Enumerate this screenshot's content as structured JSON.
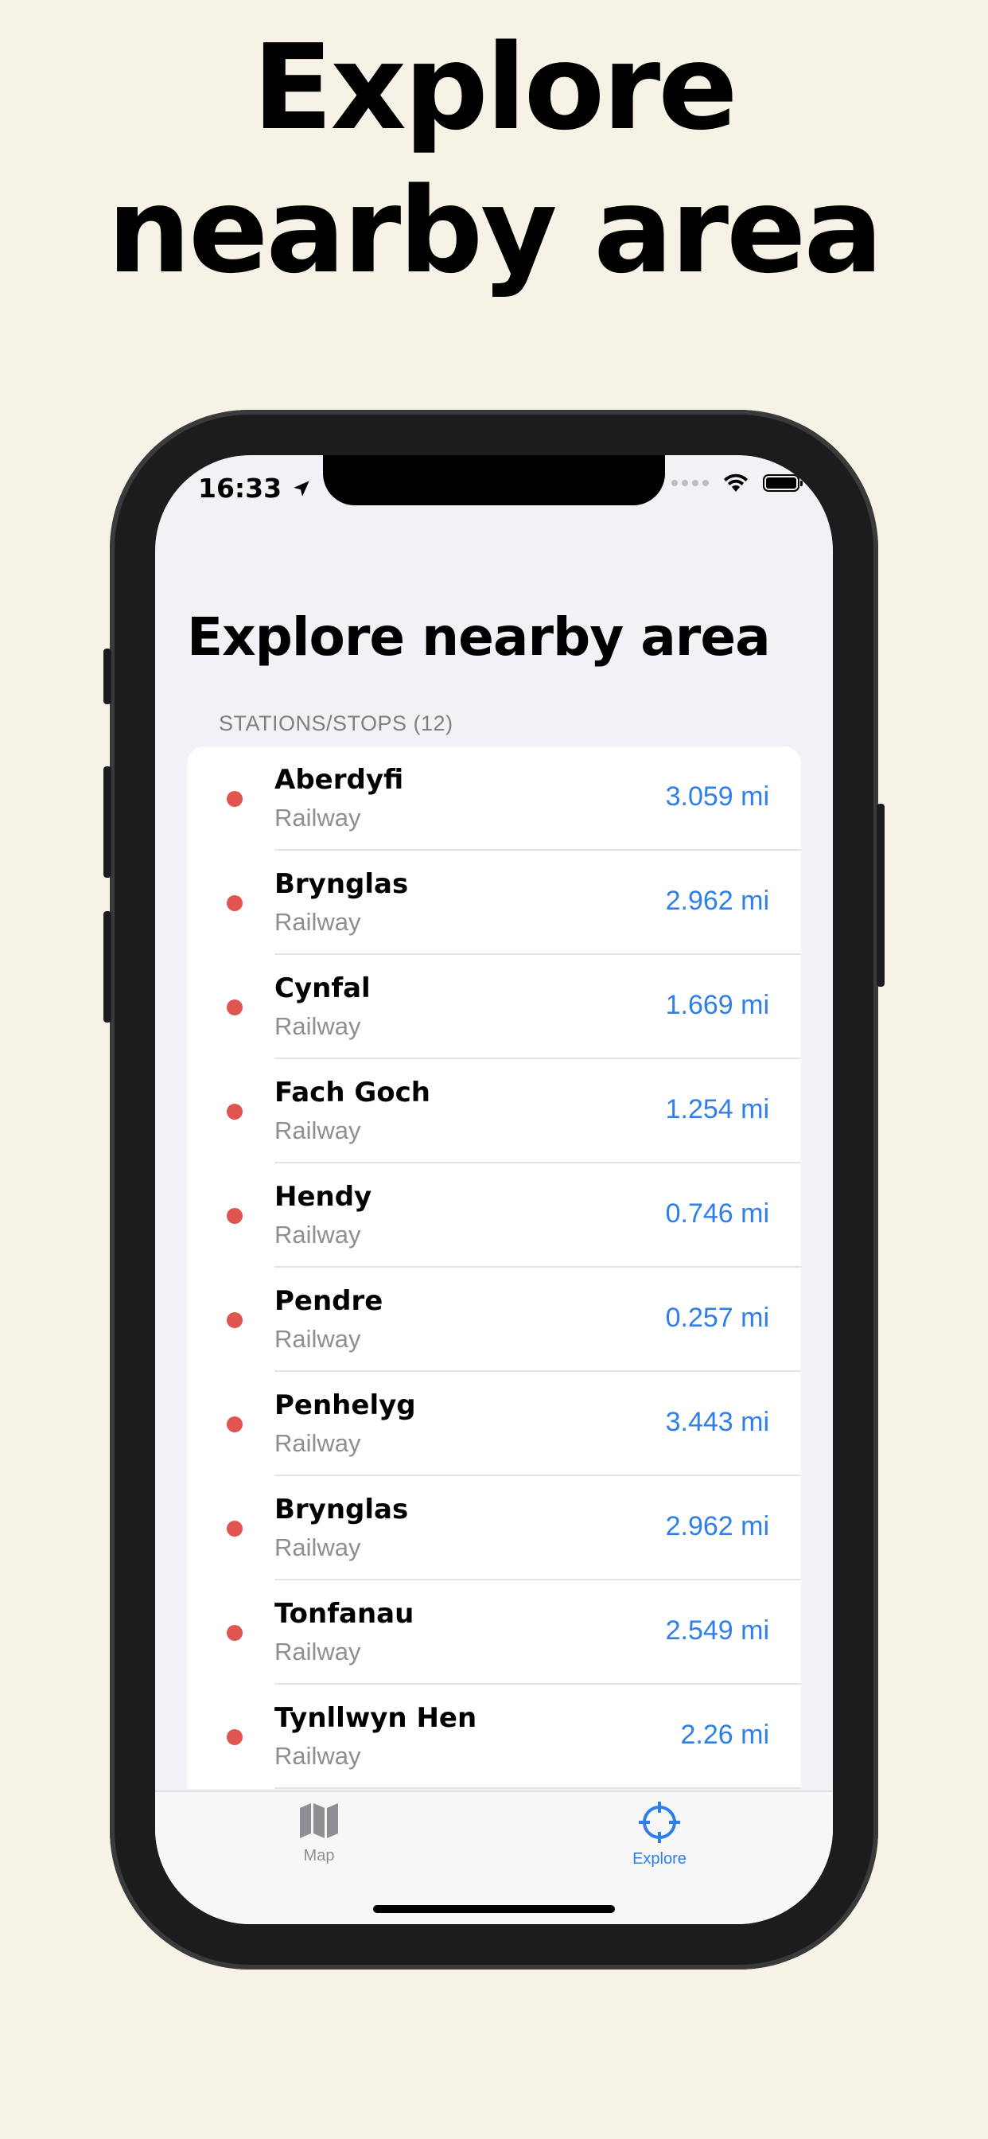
{
  "hero": {
    "line1": "Explore",
    "line2": "nearby area"
  },
  "status_bar": {
    "time": "16:33"
  },
  "page_title": "Explore nearby area",
  "section_header": "STATIONS/STOPS (12)",
  "colors": {
    "accent": "#2f7fea",
    "dot": "#e0554f",
    "background": "#f6f2e6"
  },
  "stations": [
    {
      "name": "Aberdyfi",
      "type": "Railway",
      "distance": "3.059 mi"
    },
    {
      "name": "Brynglas",
      "type": "Railway",
      "distance": "2.962 mi"
    },
    {
      "name": "Cynfal",
      "type": "Railway",
      "distance": "1.669 mi"
    },
    {
      "name": "Fach Goch",
      "type": "Railway",
      "distance": "1.254 mi"
    },
    {
      "name": "Hendy",
      "type": "Railway",
      "distance": "0.746 mi"
    },
    {
      "name": "Pendre",
      "type": "Railway",
      "distance": "0.257 mi"
    },
    {
      "name": "Penhelyg",
      "type": "Railway",
      "distance": "3.443 mi"
    },
    {
      "name": "Brynglas",
      "type": "Railway",
      "distance": "2.962 mi"
    },
    {
      "name": "Tonfanau",
      "type": "Railway",
      "distance": "2.549 mi"
    },
    {
      "name": "Tynllwyn Hen",
      "type": "Railway",
      "distance": "2.26 mi"
    }
  ],
  "tabbar": {
    "map": {
      "label": "Map",
      "icon": "map-icon"
    },
    "explore": {
      "label": "Explore",
      "icon": "crosshair-icon"
    }
  }
}
